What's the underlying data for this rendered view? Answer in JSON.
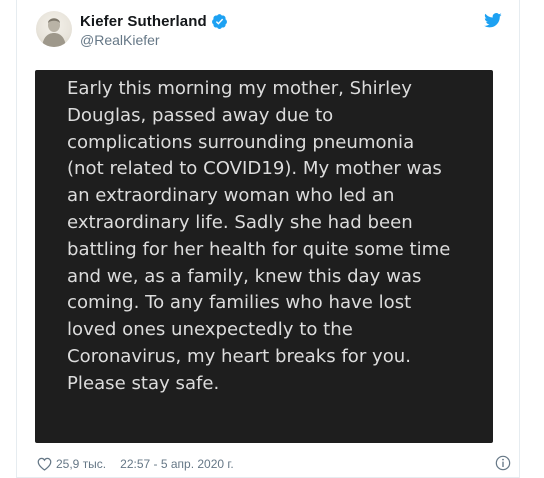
{
  "tweet": {
    "display_name": "Kiefer Sutherland",
    "handle": "@RealKiefer",
    "verified": true,
    "image_text": "Early this morning my mother, Shirley\nDouglas, passed away due to\ncomplications surrounding pneumonia\n(not related to COVID19). My mother was\nan extraordinary woman who led an\nextraordinary life. Sadly she had been\nbattling for her health for quite some time\nand we, as a family, knew this day was\ncoming. To any families who have lost\nloved ones unexpectedly to the\nCoronavirus, my heart breaks for you.\nPlease stay safe.",
    "likes": "25,9 тыс.",
    "timestamp": "22:57 - 5 апр. 2020 г."
  },
  "icons": {
    "verified": "verified-badge-icon",
    "bird": "twitter-bird-icon",
    "heart": "heart-icon",
    "info": "info-icon"
  },
  "colors": {
    "accent": "#1da1f2",
    "secondary_text": "#657786",
    "media_background": "#1e1e1e",
    "media_text": "#dcdcdc"
  }
}
